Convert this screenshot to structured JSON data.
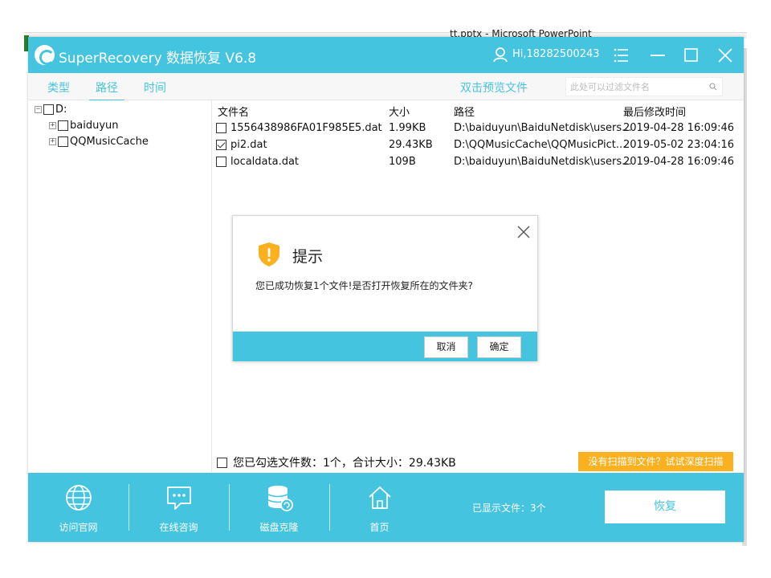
{
  "background": {
    "window_title": "tt.pptx - Microsoft PowerPoint"
  },
  "app": {
    "title": "SuperRecovery 数据恢复 V6.8",
    "user": "Hi,18282500243",
    "accent_color": "#45c4e0",
    "warning_color": "#f9b120"
  },
  "tabs": [
    {
      "label": "类型",
      "active": false
    },
    {
      "label": "路径",
      "active": true
    },
    {
      "label": "时间",
      "active": false
    }
  ],
  "preview_link": "双击预览文件",
  "filter": {
    "placeholder": "此处可以过滤文件名"
  },
  "tree": {
    "root": "D:",
    "children": [
      "baiduyun",
      "QQMusicCache"
    ]
  },
  "file_list": {
    "columns": [
      "文件名",
      "大小",
      "路径",
      "最后修改时间"
    ],
    "rows": [
      {
        "name": "1556438986FA01F985E5.dat",
        "size": "1.99KB",
        "path": "D:\\baiduyun\\BaiduNetdisk\\users...",
        "modified": "2019-04-28 16:09:46",
        "checked": false
      },
      {
        "name": "pi2.dat",
        "size": "29.43KB",
        "path": "D:\\QQMusicCache\\QQMusicPict...",
        "modified": "2019-05-02 23:04:16",
        "checked": true
      },
      {
        "name": "localdata.dat",
        "size": "109B",
        "path": "D:\\baiduyun\\BaiduNetdisk\\users...",
        "modified": "2019-04-28 16:09:46",
        "checked": false
      }
    ]
  },
  "selection_summary": "您已勾选文件数：1个，合计大小：29.43KB",
  "deep_scan_label": "没有扫描到文件？试试深度扫描",
  "bottom_nav": [
    {
      "label": "访问官网",
      "icon": "globe-icon"
    },
    {
      "label": "在线咨询",
      "icon": "chat-icon"
    },
    {
      "label": "磁盘克隆",
      "icon": "disk-clone-icon"
    },
    {
      "label": "首页",
      "icon": "home-icon"
    }
  ],
  "shown_files": "已显示文件：3个",
  "recover_label": "恢复",
  "dialog": {
    "title": "提示",
    "message": "您已成功恢复1个文件!是否打开恢复所在的文件夹?",
    "cancel": "取消",
    "ok": "确定"
  }
}
